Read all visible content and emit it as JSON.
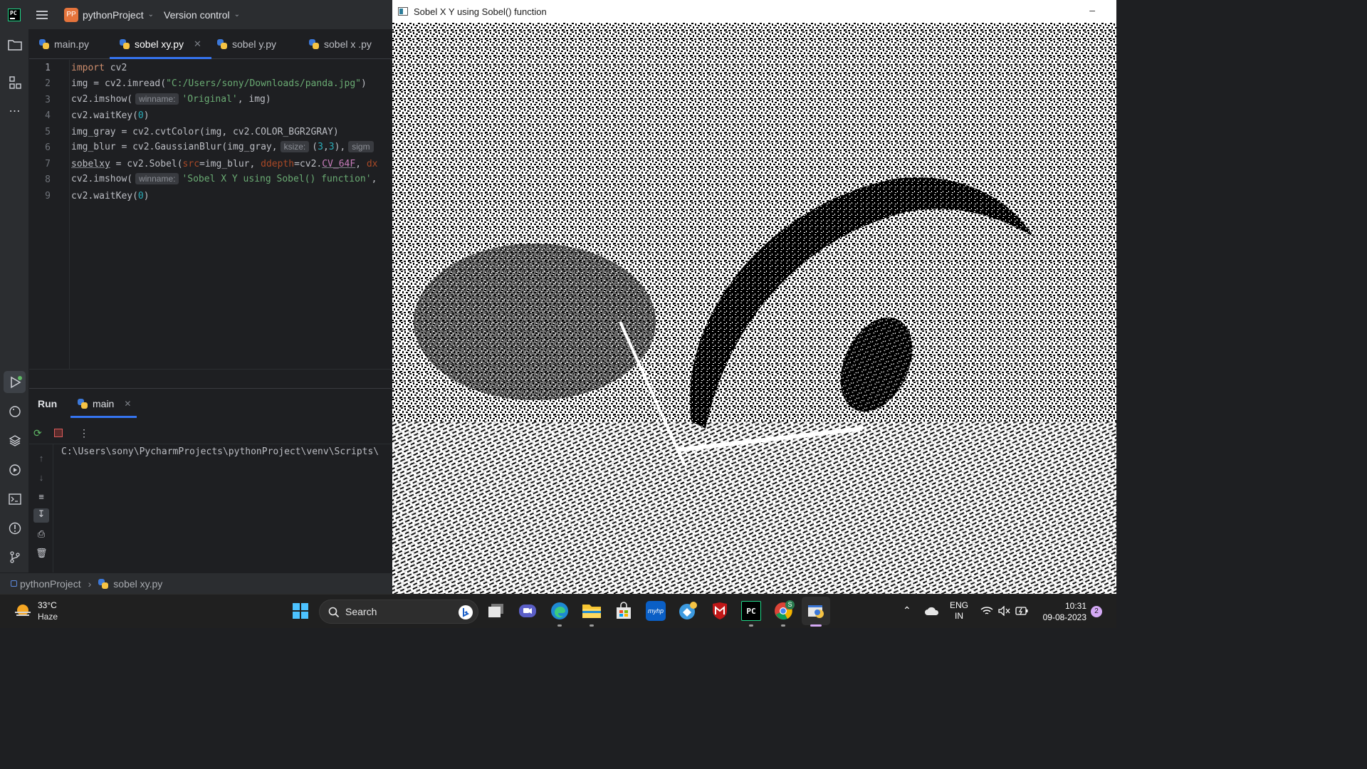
{
  "ide": {
    "logo_text": "PC",
    "project_badge": "PP",
    "project_name": "pythonProject",
    "version_control": "Version control",
    "tabs": [
      {
        "label": "main.py"
      },
      {
        "label": "sobel xy.py"
      },
      {
        "label": "sobel y.py"
      },
      {
        "label": "sobel x .py"
      }
    ],
    "line_numbers": [
      "1",
      "2",
      "3",
      "4",
      "5",
      "6",
      "7",
      "8",
      "9"
    ],
    "code": {
      "l1_kw": "import",
      "l1_rest": " cv2",
      "l2_a": "img = cv2.imread(",
      "l2_str": "\"C:/Users/sony/Downloads/panda.jpg\"",
      "l2_b": ")",
      "l3_a": "cv2.imshow(",
      "l3_hint": "winname:",
      "l3_str": "'Original'",
      "l3_b": ", img)",
      "l4_a": "cv2.waitKey(",
      "l4_num": "0",
      "l4_b": ")",
      "l5": "img_gray = cv2.cvtColor(img, cv2.COLOR_BGR2GRAY)",
      "l6_a": "img_blur = cv2.GaussianBlur(img_gray,",
      "l6_hint": "ksize:",
      "l6_b": "(",
      "l6_n1": "3",
      "l6_c": ",",
      "l6_n2": "3",
      "l6_d": "),",
      "l6_hint2": "sigm",
      "l7_var": "sobelxy",
      "l7_a": " = cv2.Sobel(",
      "l7_p1": "src",
      "l7_b": "=img_blur, ",
      "l7_p2": "ddepth",
      "l7_c": "=cv2.",
      "l7_f": "CV_64F",
      "l7_d": ", ",
      "l7_p3": "dx",
      "l8_a": "cv2.imshow(",
      "l8_hint": "winname:",
      "l8_str": "'Sobel X Y using Sobel() function'",
      "l8_b": ",",
      "l9_a": "cv2.waitKey(",
      "l9_num": "0",
      "l9_b": ")"
    },
    "run": {
      "title": "Run",
      "tab": "main",
      "console_line": "C:\\Users\\sony\\PycharmProjects\\pythonProject\\venv\\Scripts\\"
    },
    "statusbar": {
      "project": "pythonProject",
      "file": "sobel xy.py"
    }
  },
  "image_window": {
    "title": "Sobel X Y using Sobel() function",
    "minimize": "–"
  },
  "taskbar": {
    "temperature": "33°C",
    "condition": "Haze",
    "search_label": "Search",
    "language_line1": "ENG",
    "language_line2": "IN",
    "time": "10:31",
    "date": "09-08-2023",
    "notification_count": "2",
    "chrome_badge": "S",
    "pycharm_label": "PC",
    "store_app_label": "myhp"
  }
}
